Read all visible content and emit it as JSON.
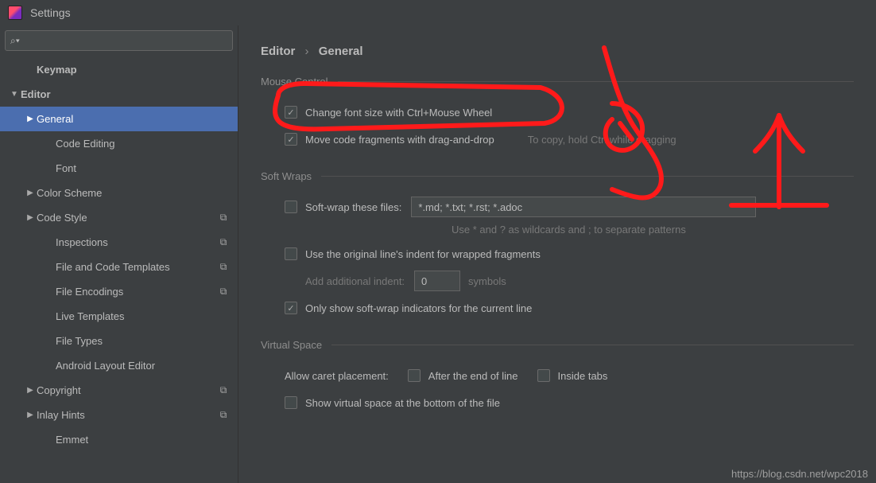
{
  "window": {
    "title": "Settings"
  },
  "search": {
    "placeholder": ""
  },
  "sidebar": {
    "items": [
      {
        "label": "Keymap",
        "indent": 1,
        "arrow": "",
        "bold": true,
        "badge": false
      },
      {
        "label": "Editor",
        "indent": 0,
        "arrow": "down",
        "bold": true,
        "badge": false
      },
      {
        "label": "General",
        "indent": 1,
        "arrow": "right",
        "bold": false,
        "selected": true,
        "badge": false
      },
      {
        "label": "Code Editing",
        "indent": 2,
        "arrow": "",
        "bold": false,
        "badge": false
      },
      {
        "label": "Font",
        "indent": 2,
        "arrow": "",
        "bold": false,
        "badge": false
      },
      {
        "label": "Color Scheme",
        "indent": 1,
        "arrow": "right",
        "bold": false,
        "badge": false
      },
      {
        "label": "Code Style",
        "indent": 1,
        "arrow": "right",
        "bold": false,
        "badge": true
      },
      {
        "label": "Inspections",
        "indent": 2,
        "arrow": "",
        "bold": false,
        "badge": true
      },
      {
        "label": "File and Code Templates",
        "indent": 2,
        "arrow": "",
        "bold": false,
        "badge": true
      },
      {
        "label": "File Encodings",
        "indent": 2,
        "arrow": "",
        "bold": false,
        "badge": true
      },
      {
        "label": "Live Templates",
        "indent": 2,
        "arrow": "",
        "bold": false,
        "badge": false
      },
      {
        "label": "File Types",
        "indent": 2,
        "arrow": "",
        "bold": false,
        "badge": false
      },
      {
        "label": "Android Layout Editor",
        "indent": 2,
        "arrow": "",
        "bold": false,
        "badge": false
      },
      {
        "label": "Copyright",
        "indent": 1,
        "arrow": "right",
        "bold": false,
        "badge": true
      },
      {
        "label": "Inlay Hints",
        "indent": 1,
        "arrow": "right",
        "bold": false,
        "badge": true
      },
      {
        "label": "Emmet",
        "indent": 2,
        "arrow": "",
        "bold": false,
        "badge": false
      }
    ]
  },
  "breadcrumb": {
    "root": "Editor",
    "leaf": "General"
  },
  "sections": {
    "mouse": {
      "title": "Mouse Control",
      "change_font": "Change font size with Ctrl+Mouse Wheel",
      "drag_drop": "Move code fragments with drag-and-drop",
      "drag_drop_hint": "To copy, hold Ctrl while dragging"
    },
    "softwraps": {
      "title": "Soft Wraps",
      "soft_wrap_label": "Soft-wrap these files:",
      "soft_wrap_value": "*.md; *.txt; *.rst; *.adoc",
      "wildcard_caption": "Use * and ? as wildcards and ; to separate patterns",
      "orig_indent": "Use the original line's indent for wrapped fragments",
      "add_indent_label": "Add additional indent:",
      "add_indent_value": "0",
      "add_indent_suffix": "symbols",
      "only_show": "Only show soft-wrap indicators for the current line"
    },
    "virtual": {
      "title": "Virtual Space",
      "allow_caret": "Allow caret placement:",
      "after_eol": "After the end of line",
      "inside_tabs": "Inside tabs",
      "show_virtual": "Show virtual space at the bottom of the file"
    }
  },
  "watermark": "https://blog.csdn.net/wpc2018",
  "glyphs": {
    "check": "✓",
    "sep": "›",
    "right": "▶",
    "down": "▼",
    "layers": "⧉",
    "search": "⌕"
  }
}
